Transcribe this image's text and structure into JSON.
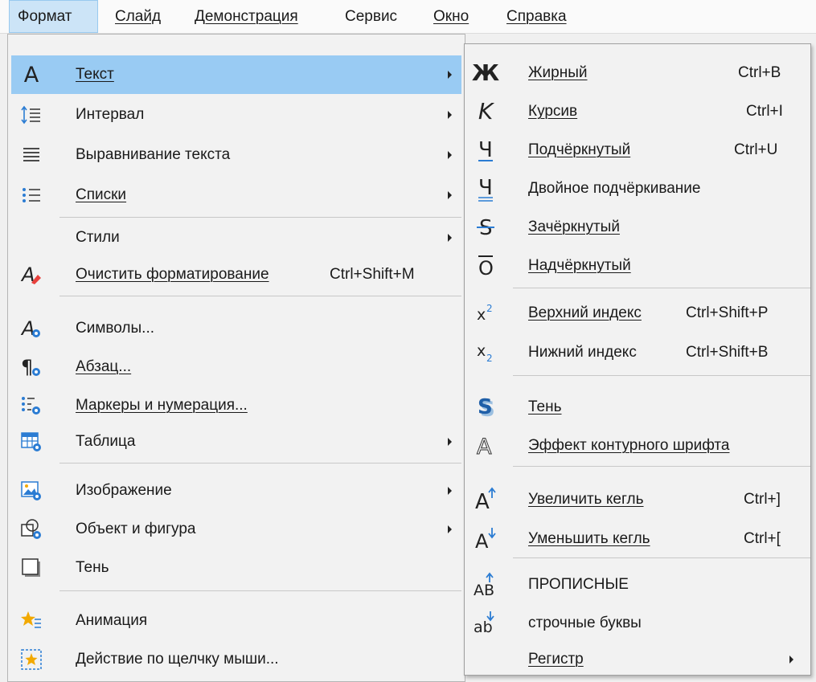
{
  "menubar": {
    "items": [
      {
        "label": "Формат"
      },
      {
        "label": "Слайд"
      },
      {
        "label": "Демонстрация"
      },
      {
        "label": "Сервис"
      },
      {
        "label": "Окно"
      },
      {
        "label": "Справка"
      }
    ]
  },
  "main_menu": {
    "items": [
      {
        "label": "Текст",
        "icon": "text-icon",
        "submenu": true,
        "highlighted": true
      },
      {
        "label": "Интервал",
        "icon": "line-spacing-icon",
        "submenu": true
      },
      {
        "label": "Выравнивание текста",
        "icon": "align-text-icon",
        "submenu": true
      },
      {
        "label": "Списки",
        "icon": "list-icon",
        "submenu": true
      },
      {
        "label": "Стили",
        "submenu": true
      },
      {
        "label": "Очистить форматирование",
        "shortcut": "Ctrl+Shift+M",
        "icon": "clear-formatting-icon"
      },
      {
        "label": "Символы...",
        "icon": "character-icon"
      },
      {
        "label": "Абзац...",
        "icon": "paragraph-icon"
      },
      {
        "label": "Маркеры и нумерация...",
        "icon": "bullets-numbering-icon"
      },
      {
        "label": "Таблица",
        "icon": "table-icon",
        "submenu": true
      },
      {
        "label": "Изображение",
        "icon": "image-icon",
        "submenu": true
      },
      {
        "label": "Объект и фигура",
        "icon": "object-shape-icon",
        "submenu": true
      },
      {
        "label": "Тень",
        "icon": "shadow-icon"
      },
      {
        "label": "Анимация",
        "icon": "animation-icon"
      },
      {
        "label": "Действие по щелчку мыши...",
        "icon": "click-action-icon"
      }
    ]
  },
  "text_submenu": {
    "items": [
      {
        "label": "Жирный",
        "shortcut": "Ctrl+B",
        "icon": "bold-icon"
      },
      {
        "label": "Курсив",
        "shortcut": "Ctrl+I",
        "icon": "italic-icon"
      },
      {
        "label": "Подчёркнутый",
        "shortcut": "Ctrl+U",
        "icon": "underline-icon"
      },
      {
        "label": "Двойное подчёркивание",
        "icon": "double-underline-icon"
      },
      {
        "label": "Зачёркнутый",
        "icon": "strikethrough-icon"
      },
      {
        "label": "Надчёркнутый",
        "icon": "overline-icon"
      },
      {
        "label": "Верхний индекс",
        "shortcut": "Ctrl+Shift+P",
        "icon": "superscript-icon"
      },
      {
        "label": "Нижний индекс",
        "shortcut": "Ctrl+Shift+B",
        "icon": "subscript-icon"
      },
      {
        "label": "Тень",
        "icon": "text-shadow-icon"
      },
      {
        "label": "Эффект контурного шрифта",
        "icon": "outline-font-icon"
      },
      {
        "label": "Увеличить кегль",
        "shortcut": "Ctrl+]",
        "icon": "grow-font-icon"
      },
      {
        "label": "Уменьшить кегль",
        "shortcut": "Ctrl+[",
        "icon": "shrink-font-icon"
      },
      {
        "label": "ПРОПИСНЫЕ",
        "icon": "uppercase-icon"
      },
      {
        "label": "строчные буквы",
        "icon": "lowercase-icon"
      },
      {
        "label": "Регистр",
        "submenu": true
      }
    ]
  },
  "colors": {
    "highlight": "#99cbf3",
    "menubar_active": "#cce4f7",
    "menu_bg": "#f2f2f2",
    "accent_blue": "#2b7cd3",
    "red": "#e8403c"
  }
}
